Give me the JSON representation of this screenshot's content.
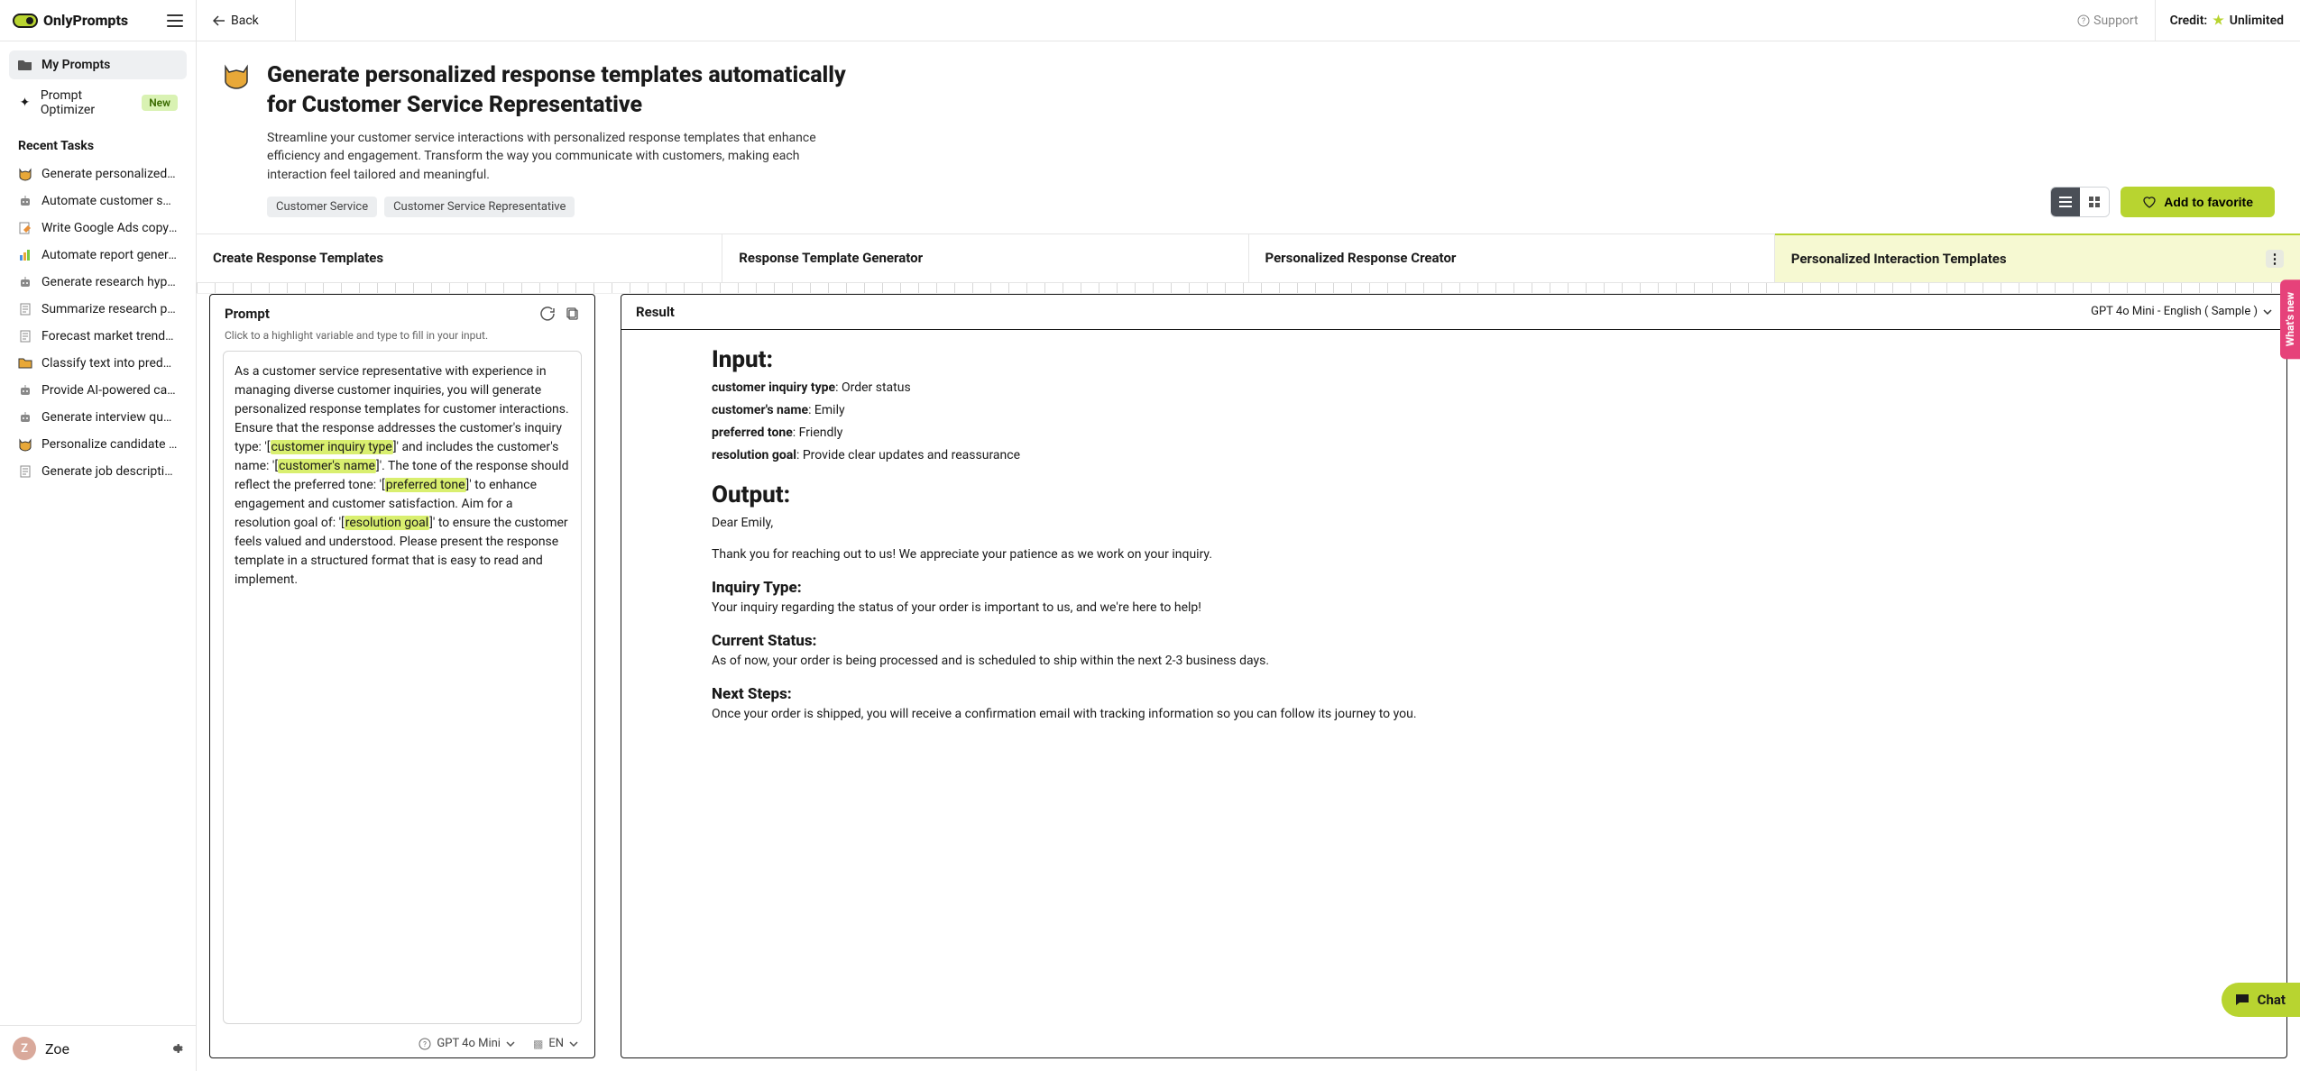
{
  "brand": {
    "name": "OnlyPrompts"
  },
  "topbar": {
    "back": "Back",
    "support": "Support",
    "credit_label": "Credit:",
    "credit_value": "Unlimited"
  },
  "sidebar": {
    "nav": {
      "my_prompts": "My Prompts",
      "optimizer": "Prompt Optimizer",
      "new_badge": "New"
    },
    "recent_title": "Recent Tasks",
    "recent": [
      {
        "icon": "cat",
        "label": "Generate personalized r..."
      },
      {
        "icon": "robot",
        "label": "Automate customer sup..."
      },
      {
        "icon": "doc-edit",
        "label": "Write Google Ads copy v..."
      },
      {
        "icon": "chart",
        "label": "Automate report generat..."
      },
      {
        "icon": "robot",
        "label": "Generate research hypot..."
      },
      {
        "icon": "doc",
        "label": "Summarize research pap..."
      },
      {
        "icon": "doc",
        "label": "Forecast market trends ..."
      },
      {
        "icon": "folder",
        "label": "Classify text into predefi..."
      },
      {
        "icon": "robot",
        "label": "Provide AI-powered cand..."
      },
      {
        "icon": "robot",
        "label": "Generate interview ques..."
      },
      {
        "icon": "cat",
        "label": "Personalize candidate o..."
      },
      {
        "icon": "doc",
        "label": "Generate job description..."
      }
    ],
    "user": {
      "initial": "Z",
      "name": "Zoe"
    }
  },
  "page": {
    "title": "Generate personalized response templates automatically for Customer Service Representative",
    "description": "Streamline your customer service interactions with personalized response templates that enhance efficiency and engagement. Transform the way you communicate with customers, making each interaction feel tailored and meaningful.",
    "tags": [
      "Customer Service",
      "Customer Service Representative"
    ],
    "fav_label": "Add to favorite"
  },
  "tabs": [
    "Create Response Templates",
    "Response Template Generator",
    "Personalized Response Creator",
    "Personalized Interaction Templates"
  ],
  "prompt_panel": {
    "title": "Prompt",
    "hint": "Click to a highlight variable and type to fill in your input.",
    "text_parts": [
      "As a customer service representative with experience in managing diverse customer inquiries, you will generate personalized response templates for customer interactions. Ensure that the response addresses the customer's inquiry type: '[",
      "customer inquiry type",
      "]' and includes the customer's name: '[",
      "customer's name",
      "]'. The tone of the response should reflect the preferred tone: '[",
      "preferred tone",
      "]' to enhance engagement and customer satisfaction. Aim for a resolution goal of: '[",
      "resolution goal",
      "]' to ensure the customer feels valued and understood. Please present the response template in a structured format that is easy to read and implement."
    ],
    "model": "GPT 4o Mini",
    "lang": "EN"
  },
  "result_panel": {
    "title": "Result",
    "meta": "GPT 4o Mini - English ( Sample )",
    "input_heading": "Input:",
    "input_fields": [
      {
        "k": "customer inquiry type",
        "v": ": Order status"
      },
      {
        "k": "customer's name",
        "v": ": Emily"
      },
      {
        "k": "preferred tone",
        "v": ": Friendly"
      },
      {
        "k": "resolution goal",
        "v": ": Provide clear updates and reassurance"
      }
    ],
    "output_heading": "Output:",
    "greeting": "Dear Emily,",
    "intro": "Thank you for reaching out to us! We appreciate your patience as we work on your inquiry.",
    "sections": [
      {
        "h": "Inquiry Type:",
        "p": "Your inquiry regarding the status of your order is important to us, and we're here to help!"
      },
      {
        "h": "Current Status:",
        "p": "As of now, your order is being processed and is scheduled to ship within the next 2-3 business days."
      },
      {
        "h": "Next Steps:",
        "p": "Once your order is shipped, you will receive a confirmation email with tracking information so you can follow its journey to you."
      }
    ]
  },
  "widgets": {
    "whats_new": "What's new",
    "chat": "Chat"
  }
}
